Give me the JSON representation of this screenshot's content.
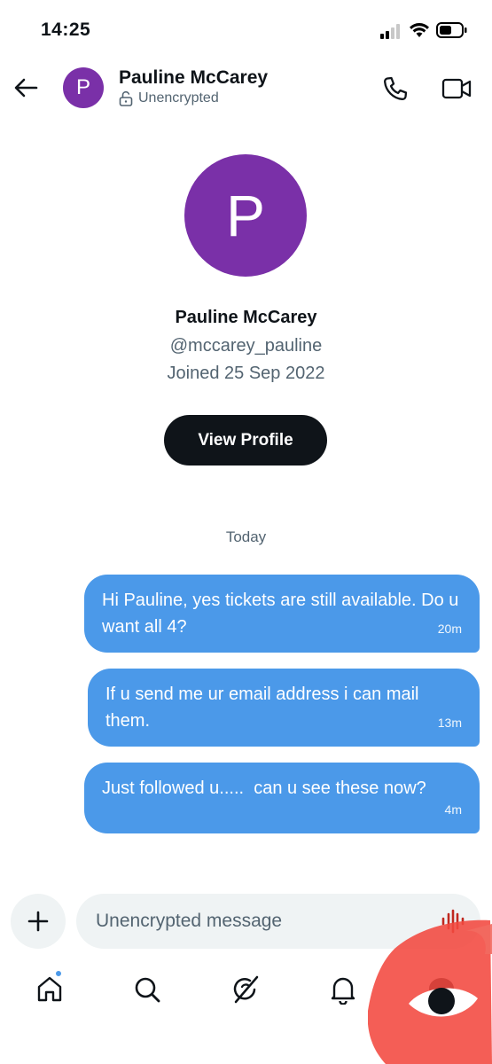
{
  "status_bar": {
    "time": "14:25"
  },
  "header": {
    "contact_initial": "P",
    "contact_name": "Pauline McCarey",
    "encryption_status": "Unencrypted"
  },
  "profile": {
    "initial": "P",
    "name": "Pauline McCarey",
    "handle": "@mccarey_pauline",
    "joined": "Joined 25 Sep 2022",
    "view_profile_label": "View Profile"
  },
  "conversation": {
    "date_label": "Today",
    "messages": [
      {
        "text": "Hi Pauline, yes tickets are still available. Do u want all 4?",
        "time": "20m"
      },
      {
        "text": "If u send me ur email address i can mail them.",
        "time": "13m"
      },
      {
        "text": "Just followed u.....  can u see these now?",
        "time": "4m"
      }
    ]
  },
  "composer": {
    "placeholder": "Unencrypted message"
  },
  "bottom_nav": {
    "items": [
      "home-icon",
      "search-icon",
      "grok-icon",
      "bell-icon",
      "messages-icon"
    ],
    "home_has_notification": true
  },
  "colors": {
    "accent": "#4b99e9",
    "avatar": "#7a30a8",
    "text_primary": "#0f1419",
    "text_secondary": "#536471",
    "input_bg": "#eff3f4",
    "overlay_red": "#f2483f"
  }
}
